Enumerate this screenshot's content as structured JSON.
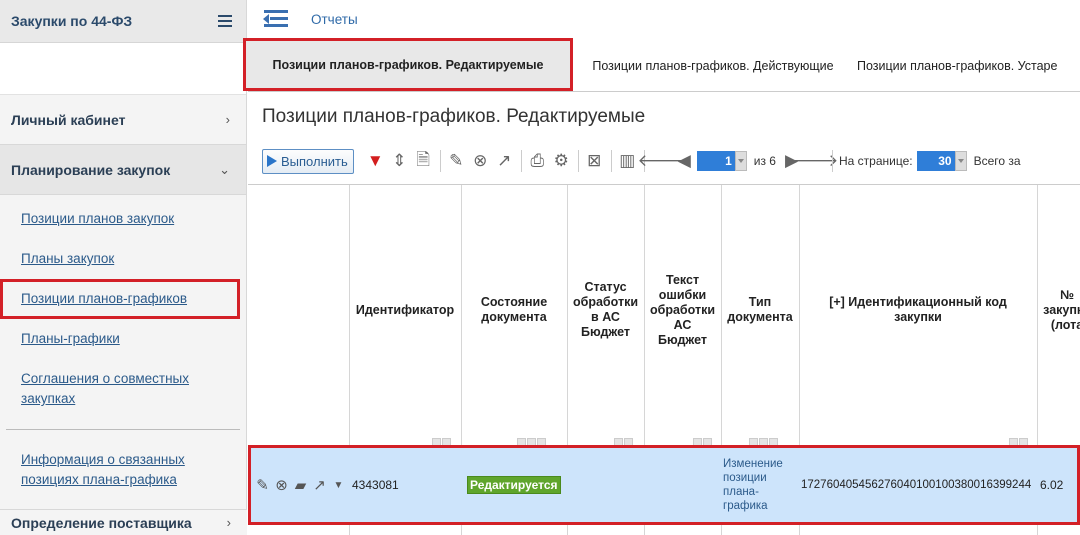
{
  "sidebar": {
    "title": "Закупки по 44-ФЗ",
    "sections": {
      "cabinet": "Личный кабинет",
      "planning": "Планирование закупок",
      "supplier": "Определение поставщика"
    },
    "items": [
      "Позиции планов закупок",
      "Планы закупок",
      "Позиции планов-графиков",
      "Планы-графики",
      "Соглашения о совместных закупках",
      "Информация о связанных позициях плана-графика"
    ]
  },
  "topbar": {
    "link": "Отчеты"
  },
  "tabs": [
    "Позиции планов-графиков. Редактируемые",
    "Позиции планов-графиков. Действующие",
    "Позиции планов-графиков. Устаре"
  ],
  "page_title": "Позиции планов-графиков. Редактируемые",
  "toolbar": {
    "run_label": "Выполнить",
    "page_value": "1",
    "of_pages": "из 6",
    "per_page_label": "На странице:",
    "per_page_value": "30",
    "total_label": "Всего за"
  },
  "table": {
    "headers": [
      "Идентификатор",
      "Состояние документа",
      "Статус обработки в АС Бюджет",
      "Текст ошибки обработки АС Бюджет",
      "Тип документа",
      "[+] Идентификационный код закупки",
      "№ закупки (лота"
    ],
    "row": {
      "id": "4343081",
      "state": "Редактируется",
      "status": "",
      "error": "",
      "type": "Изменение позиции плана-графика",
      "code": "172760405456276040100100380016399244",
      "number": "6.02"
    }
  },
  "colors": {
    "accent": "#2f6aa8",
    "highlight": "#d32027",
    "row_bg": "#cde4fb",
    "badge": "#5fa52c"
  }
}
